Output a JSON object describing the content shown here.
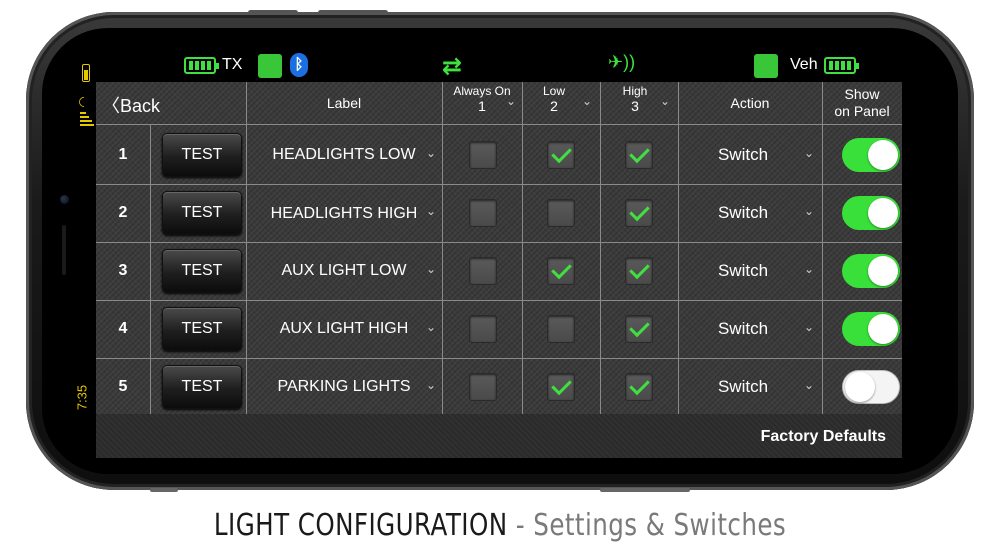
{
  "status": {
    "time": "7:35"
  },
  "topbar": {
    "tx_label": "TX",
    "veh_label": "Veh"
  },
  "header": {
    "back_label": "Back",
    "label_col": "Label",
    "always_on_col": "Always On",
    "always_on_num": "1",
    "low_col": "Low",
    "low_num": "2",
    "high_col": "High",
    "high_num": "3",
    "action_col": "Action",
    "show_col_1": "Show",
    "show_col_2": "on Panel"
  },
  "rows": [
    {
      "num": "1",
      "test": "TEST",
      "label": "HEADLIGHTS LOW",
      "always_on": false,
      "low": true,
      "high": true,
      "action": "Switch",
      "show": true
    },
    {
      "num": "2",
      "test": "TEST",
      "label": "HEADLIGHTS HIGH",
      "always_on": false,
      "low": false,
      "high": true,
      "action": "Switch",
      "show": true
    },
    {
      "num": "3",
      "test": "TEST",
      "label": "AUX LIGHT LOW",
      "always_on": false,
      "low": true,
      "high": true,
      "action": "Switch",
      "show": true
    },
    {
      "num": "4",
      "test": "TEST",
      "label": "AUX LIGHT HIGH",
      "always_on": false,
      "low": false,
      "high": true,
      "action": "Switch",
      "show": true
    },
    {
      "num": "5",
      "test": "TEST",
      "label": "PARKING LIGHTS",
      "always_on": false,
      "low": true,
      "high": true,
      "action": "Switch",
      "show": false
    }
  ],
  "footer": {
    "factory_label": "Factory Defaults"
  },
  "caption": {
    "main": "LIGHT CONFIGURATION",
    "sub": " - Settings & Switches"
  },
  "colors": {
    "accent_green": "#3fe03f",
    "bluetooth": "#1c6fe0",
    "status_yellow": "#e6c800"
  }
}
